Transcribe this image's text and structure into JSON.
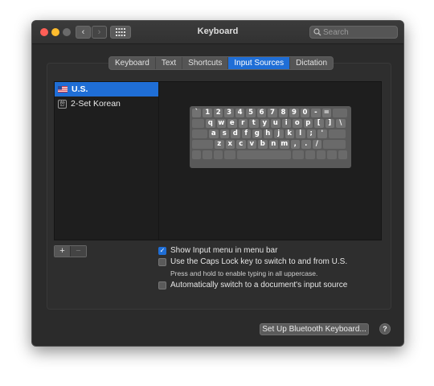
{
  "window": {
    "title": "Keyboard",
    "nav_back": "‹",
    "nav_forward": "›",
    "search_placeholder": "Search"
  },
  "tabs": [
    {
      "label": "Keyboard",
      "active": false
    },
    {
      "label": "Text",
      "active": false
    },
    {
      "label": "Shortcuts",
      "active": false
    },
    {
      "label": "Input Sources",
      "active": true
    },
    {
      "label": "Dictation",
      "active": false
    }
  ],
  "input_sources": [
    {
      "label": "U.S.",
      "icon": "us-flag-icon",
      "selected": true
    },
    {
      "label": "2-Set Korean",
      "icon": "korean-input-icon",
      "selected": false
    }
  ],
  "keyboard_rows": [
    [
      "`",
      "1",
      "2",
      "3",
      "4",
      "5",
      "6",
      "7",
      "8",
      "9",
      "0",
      "-",
      "="
    ],
    [
      "q",
      "w",
      "e",
      "r",
      "t",
      "y",
      "u",
      "i",
      "o",
      "p",
      "[",
      "]",
      "\\"
    ],
    [
      "a",
      "s",
      "d",
      "f",
      "g",
      "h",
      "j",
      "k",
      "l",
      ";",
      "'"
    ],
    [
      "z",
      "x",
      "c",
      "v",
      "b",
      "n",
      "m",
      ",",
      ".",
      "/"
    ]
  ],
  "list_controls": {
    "add": "+",
    "remove": "−"
  },
  "options": {
    "show_menu": {
      "label": "Show Input menu in menu bar",
      "checked": true
    },
    "caps_lock": {
      "label": "Use the Caps Lock key to switch to and from U.S.",
      "checked": false
    },
    "caps_hint": "Press and hold to enable typing in all uppercase.",
    "auto_switch": {
      "label": "Automatically switch to a document's input source",
      "checked": false
    }
  },
  "footer": {
    "bluetooth_button": "Set Up Bluetooth Keyboard...",
    "help": "?"
  },
  "colors": {
    "accent": "#1f6ed6",
    "window_bg": "#2b2b2b",
    "list_bg": "#1e1e1e"
  }
}
